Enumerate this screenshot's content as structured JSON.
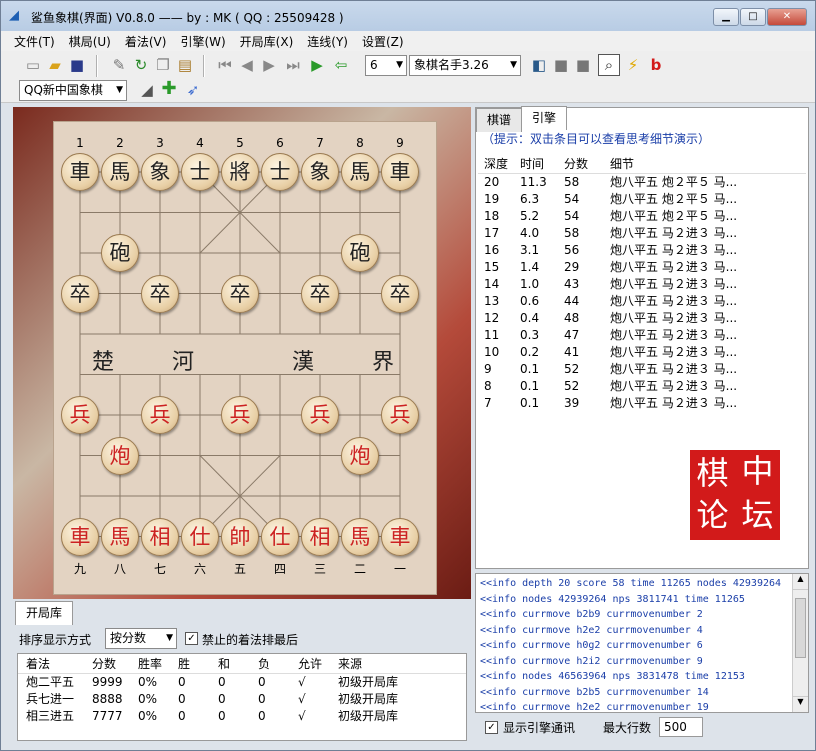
{
  "window": {
    "title": "鲨鱼象棋(界面) V0.8.0   —— by : MK ( QQ : 25509428 )",
    "min": "▁",
    "max": "□",
    "close": "✕"
  },
  "menu": [
    "文件(T)",
    "棋局(U)",
    "着法(V)",
    "引擎(W)",
    "开局库(X)",
    "连线(Y)",
    "设置(Z)"
  ],
  "toolbar": {
    "depth_value": "6",
    "engine_value": "象棋名手3.26",
    "board_style_value": "QQ新中国象棋",
    "engine_icon_label": "b"
  },
  "board": {
    "top_coords": [
      "1",
      "2",
      "3",
      "4",
      "5",
      "6",
      "7",
      "8",
      "9"
    ],
    "bottom_coords": [
      "九",
      "八",
      "七",
      "六",
      "五",
      "四",
      "三",
      "二",
      "一"
    ],
    "river_left": [
      "楚",
      "河"
    ],
    "river_right": [
      "漢",
      "界"
    ],
    "pieces": [
      {
        "ch": "車",
        "side": "black"
      },
      {
        "ch": "馬",
        "side": "black"
      },
      {
        "ch": "象",
        "side": "black"
      },
      {
        "ch": "士",
        "side": "black"
      },
      {
        "ch": "將",
        "side": "black"
      },
      {
        "ch": "士",
        "side": "black"
      },
      {
        "ch": "象",
        "side": "black"
      },
      {
        "ch": "馬",
        "side": "black"
      },
      {
        "ch": "車",
        "side": "black"
      },
      {
        "ch": "砲",
        "side": "black"
      },
      {
        "ch": "砲",
        "side": "black"
      },
      {
        "ch": "卒",
        "side": "black"
      },
      {
        "ch": "卒",
        "side": "black"
      },
      {
        "ch": "卒",
        "side": "black"
      },
      {
        "ch": "卒",
        "side": "black"
      },
      {
        "ch": "卒",
        "side": "black"
      },
      {
        "ch": "兵",
        "side": "red"
      },
      {
        "ch": "兵",
        "side": "red"
      },
      {
        "ch": "兵",
        "side": "red"
      },
      {
        "ch": "兵",
        "side": "red"
      },
      {
        "ch": "兵",
        "side": "red"
      },
      {
        "ch": "炮",
        "side": "red"
      },
      {
        "ch": "炮",
        "side": "red"
      },
      {
        "ch": "車",
        "side": "red"
      },
      {
        "ch": "馬",
        "side": "red"
      },
      {
        "ch": "相",
        "side": "red"
      },
      {
        "ch": "仕",
        "side": "red"
      },
      {
        "ch": "帥",
        "side": "red"
      },
      {
        "ch": "仕",
        "side": "red"
      },
      {
        "ch": "相",
        "side": "red"
      },
      {
        "ch": "馬",
        "side": "red"
      },
      {
        "ch": "車",
        "side": "red"
      }
    ]
  },
  "right_tabs": {
    "tab1": "棋谱",
    "tab2": "引擎"
  },
  "engine": {
    "hint": "（提示：双击条目可以查看思考细节演示）",
    "headers": [
      "深度",
      "时间",
      "分数",
      "细节"
    ],
    "rows": [
      [
        "20",
        "11.3",
        "58",
        "炮八平五 炮２平５ 马..."
      ],
      [
        "19",
        "6.3",
        "54",
        "炮八平五 炮２平５ 马..."
      ],
      [
        "18",
        "5.2",
        "54",
        "炮八平五 炮２平５ 马..."
      ],
      [
        "17",
        "4.0",
        "58",
        "炮八平五 马２进３ 马..."
      ],
      [
        "16",
        "3.1",
        "56",
        "炮八平五 马２进３ 马..."
      ],
      [
        "15",
        "1.4",
        "29",
        "炮八平五 马２进３ 马..."
      ],
      [
        "14",
        "1.0",
        "43",
        "炮八平五 马２进３ 马..."
      ],
      [
        "13",
        "0.6",
        "44",
        "炮八平五 马２进３ 马..."
      ],
      [
        "12",
        "0.4",
        "48",
        "炮八平五 马２进３ 马..."
      ],
      [
        "11",
        "0.3",
        "47",
        "炮八平五 马２进３ 马..."
      ],
      [
        "10",
        "0.2",
        "41",
        "炮八平五 马２进３ 马..."
      ],
      [
        "9",
        "0.1",
        "52",
        "炮八平五 马２进３ 马..."
      ],
      [
        "8",
        "0.1",
        "52",
        "炮八平五 马２进３ 马..."
      ],
      [
        "7",
        "0.1",
        "39",
        "炮八平五 马２进３ 马..."
      ]
    ]
  },
  "seal": [
    "中",
    "棋",
    "坛",
    "论"
  ],
  "log": [
    "<<info depth 20 score 58 time 11265 nodes 42939264",
    "<<info nodes 42939264 nps 3811741 time 11265",
    "<<info currmove b2b9 currmovenumber 2",
    "<<info currmove h2e2 currmovenumber 4",
    "<<info currmove h0g2 currmovenumber 6",
    "<<info currmove h2i2 currmovenumber 9",
    "<<info nodes 46563964 nps 3831478 time 12153",
    "<<info currmove b2b5 currmovenumber 14",
    "<<info currmove h2e2 currmovenumber 19"
  ],
  "log_controls": {
    "show_comm": "显示引擎通讯",
    "max_lines_label": "最大行数",
    "max_lines_value": "500"
  },
  "opening": {
    "tab": "开局库",
    "sort_label": "排序显示方式",
    "sort_value": "按分数",
    "ban_label": "禁止的着法排最后",
    "headers": [
      "着法",
      "分数",
      "胜率",
      "胜",
      "和",
      "负",
      "允许",
      "来源"
    ],
    "rows": [
      [
        "炮二平五",
        "9999",
        "0%",
        "0",
        "0",
        "0",
        "√",
        "初级开局库"
      ],
      [
        "兵七进一",
        "8888",
        "0%",
        "0",
        "0",
        "0",
        "√",
        "初级开局库"
      ],
      [
        "相三进五",
        "7777",
        "0%",
        "0",
        "0",
        "0",
        "√",
        "初级开局库"
      ]
    ]
  }
}
